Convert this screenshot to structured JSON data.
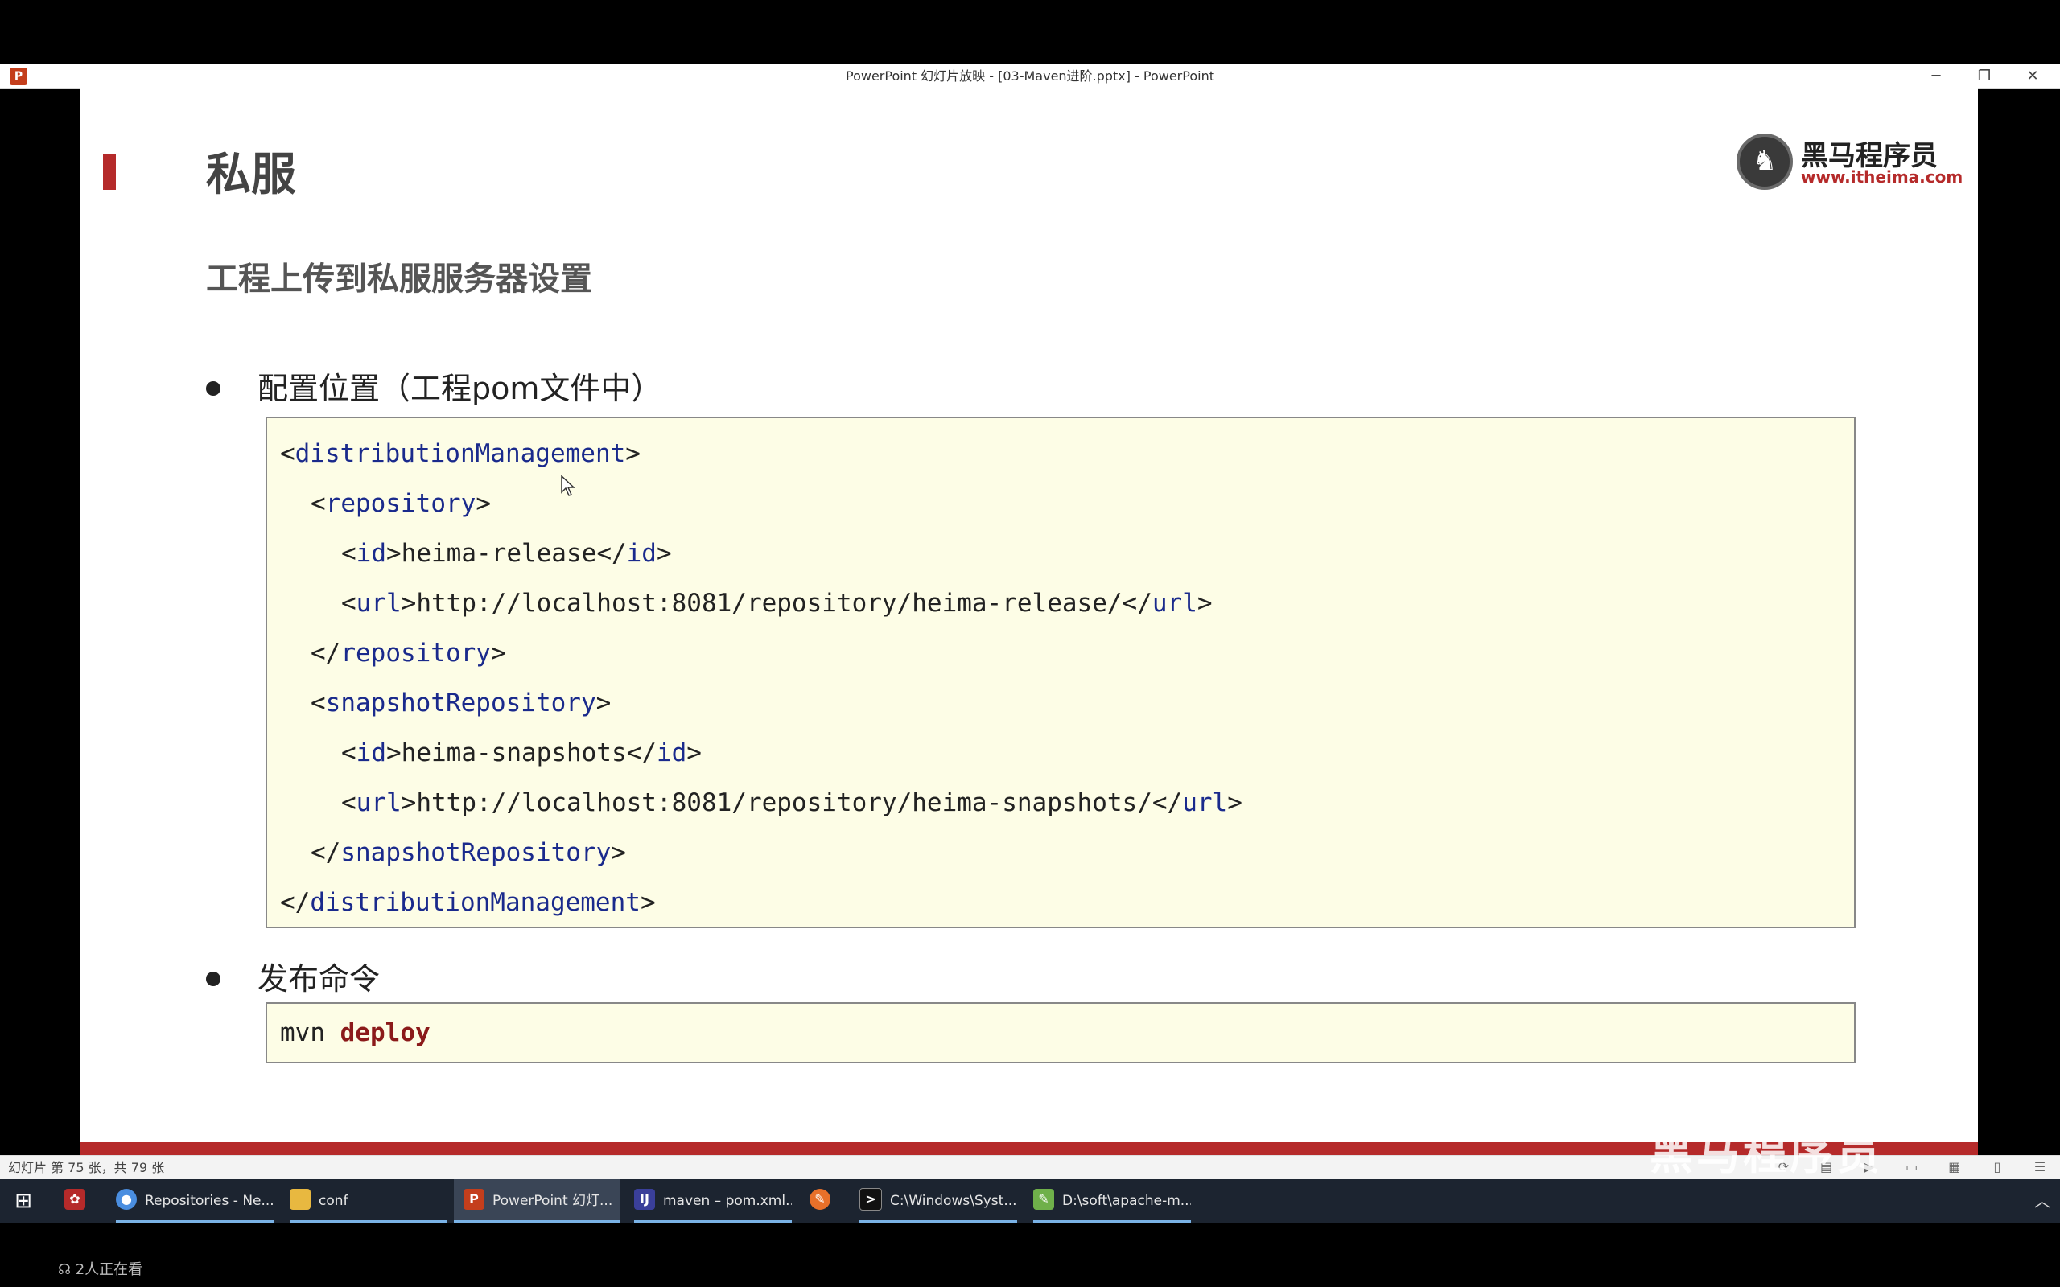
{
  "window": {
    "title": "PowerPoint 幻灯片放映 - [03-Maven进阶.pptx] - PowerPoint",
    "app_icon": "P",
    "controls": {
      "minimize": "─",
      "restore": "❐",
      "close": "✕"
    }
  },
  "slide": {
    "title": "私服",
    "logo": {
      "name": "黑马程序员",
      "url": "www.itheima.com"
    },
    "subtitle": "工程上传到私服服务器设置",
    "bullets": [
      {
        "label": "配置位置（工程pom文件中）"
      },
      {
        "label": "发布命令"
      }
    ],
    "code1": {
      "l1": {
        "open": "<",
        "tag": "distributionManagement",
        "close": ">"
      },
      "l2": {
        "open": "<",
        "tag": "repository",
        "close": ">"
      },
      "l3": {
        "o1": "<",
        "tag": "id",
        "c1": ">",
        "text": "heima-release",
        "o2": "</",
        "tag2": "id",
        "c2": ">"
      },
      "l4": {
        "o1": "<",
        "tag": "url",
        "c1": ">",
        "text": "http://localhost:8081/repository/heima-release/",
        "o2": "</",
        "tag2": "url",
        "c2": ">"
      },
      "l5": {
        "open": "</",
        "tag": "repository",
        "close": ">"
      },
      "l6": {
        "open": "<",
        "tag": "snapshotRepository",
        "close": ">"
      },
      "l7": {
        "o1": "<",
        "tag": "id",
        "c1": ">",
        "text": "heima-snapshots",
        "o2": "</",
        "tag2": "id",
        "c2": ">"
      },
      "l8": {
        "o1": "<",
        "tag": "url",
        "c1": ">",
        "text": "http://localhost:8081/repository/heima-snapshots/",
        "o2": "</",
        "tag2": "url",
        "c2": ">"
      },
      "l9": {
        "open": "</",
        "tag": "snapshotRepository",
        "close": ">"
      },
      "l10": {
        "open": "</",
        "tag": "distributionManagement",
        "close": ">"
      }
    },
    "code2": {
      "cmd": "mvn",
      "arg": "deploy"
    },
    "colors": {
      "accent": "#b52a2a",
      "code_bg": "#fdfde6",
      "tag": "#1a2a8c"
    }
  },
  "statusbar": {
    "slide_count": "幻灯片 第 75 张，共 79 张"
  },
  "watermark": "黑马程序员",
  "taskbar": {
    "items": [
      {
        "label": "Repositories - Ne...",
        "icon": "chrome-icon"
      },
      {
        "label": "conf",
        "icon": "folder-icon"
      },
      {
        "label": "PowerPoint 幻灯...",
        "icon": "powerpoint-icon"
      },
      {
        "label": "maven – pom.xml...",
        "icon": "intellij-icon"
      },
      {
        "label": "",
        "icon": "app-orange-icon"
      },
      {
        "label": "C:\\Windows\\Syst...",
        "icon": "cmd-icon"
      },
      {
        "label": "D:\\soft\\apache-m...",
        "icon": "notepad-icon"
      }
    ]
  },
  "viewers": "2人正在看"
}
